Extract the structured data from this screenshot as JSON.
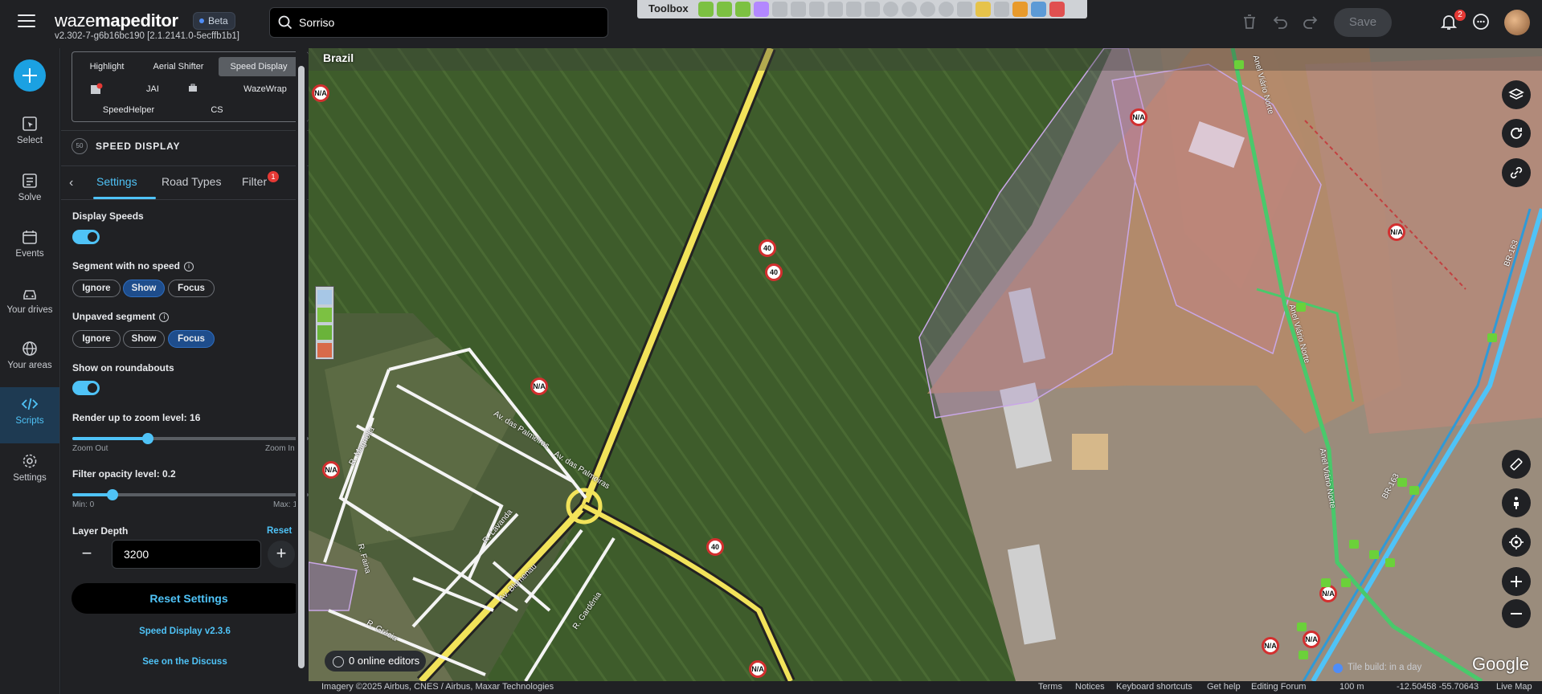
{
  "app": {
    "logo_light": "waze",
    "logo_bold": "mapeditor",
    "beta_label": "Beta",
    "version": "v2.302-7-g6b16bc190 [2.1.2141.0-5ecffb1b1]"
  },
  "search": {
    "value": "Sorriso"
  },
  "toolbox": {
    "label": "Toolbox"
  },
  "header": {
    "save_label": "Save",
    "notifications_count": "2"
  },
  "nav": {
    "items": [
      {
        "label": "Select",
        "icon": "select-icon"
      },
      {
        "label": "Solve",
        "icon": "solve-icon"
      },
      {
        "label": "Events",
        "icon": "events-icon"
      },
      {
        "label": "Your drives",
        "icon": "car-icon"
      },
      {
        "label": "Your areas",
        "icon": "globe-icon"
      },
      {
        "label": "Scripts",
        "icon": "code-icon",
        "active": true
      },
      {
        "label": "Settings",
        "icon": "gear-icon"
      }
    ]
  },
  "script_tabs": {
    "row1": [
      "Highlight",
      "Aerial Shifter",
      "Speed Display"
    ],
    "row2": [
      "JAI",
      "WazeWrap"
    ],
    "row3": [
      "SpeedHelper",
      "CS"
    ],
    "active": "Speed Display"
  },
  "speed_display": {
    "icon_text": "50",
    "title": "SPEED DISPLAY",
    "subtabs": [
      "Settings",
      "Road Types",
      "Filter"
    ],
    "filter_badge": "1",
    "display_speeds_label": "Display Speeds",
    "display_speeds_on": true,
    "no_speed_label": "Segment with no speed",
    "no_speed_options": [
      "Ignore",
      "Show",
      "Focus"
    ],
    "no_speed_selected": "Show",
    "unpaved_label": "Unpaved segment",
    "unpaved_options": [
      "Ignore",
      "Show",
      "Focus"
    ],
    "unpaved_selected": "Focus",
    "roundabouts_label": "Show on roundabouts",
    "roundabouts_on": true,
    "zoom_label": "Render up to zoom level: 16",
    "zoom_fraction": 0.32,
    "zoom_min_label": "Zoom Out",
    "zoom_max_label": "Zoom In",
    "opacity_label": "Filter opacity level: 0.2",
    "opacity_fraction": 0.17,
    "opacity_min_label": "Min: 0",
    "opacity_max_label": "Max: 1",
    "depth_label": "Layer Depth",
    "depth_reset": "Reset",
    "depth_value": "3200",
    "reset_settings": "Reset Settings",
    "version_link": "Speed Display v2.3.6",
    "discuss_link": "See on the Discuss"
  },
  "map": {
    "country": "Brazil",
    "street_labels": [
      "Av. das Palmeiras",
      "Av. das Palmeiras",
      "R. Magnólia",
      "R. Lavanda",
      "R. Faina",
      "Av. Blumenau",
      "R. Gardênia",
      "R. Grécia",
      "Anel Viário Norte",
      "Anel Viário Norte",
      "Anel Viário Norte",
      "BR-163",
      "BR-163"
    ],
    "speed_labels": [
      "N/A",
      "40",
      "40",
      "N/A",
      "N/A",
      "40",
      "N/A",
      "N/A",
      "N/A",
      "N/A",
      "N/A",
      "N/A"
    ],
    "online_editors": "0 online editors",
    "tile_build": "Tile build: in a day",
    "google": "Google"
  },
  "footer": {
    "imagery": "Imagery ©2025 Airbus, CNES / Airbus, Maxar Technologies",
    "links": [
      "Terms",
      "Notices",
      "Keyboard shortcuts",
      "Get help",
      "Editing Forum"
    ],
    "scale": "100 m",
    "coords": "-12.50458 -55.70643",
    "live_map": "Live Map"
  }
}
